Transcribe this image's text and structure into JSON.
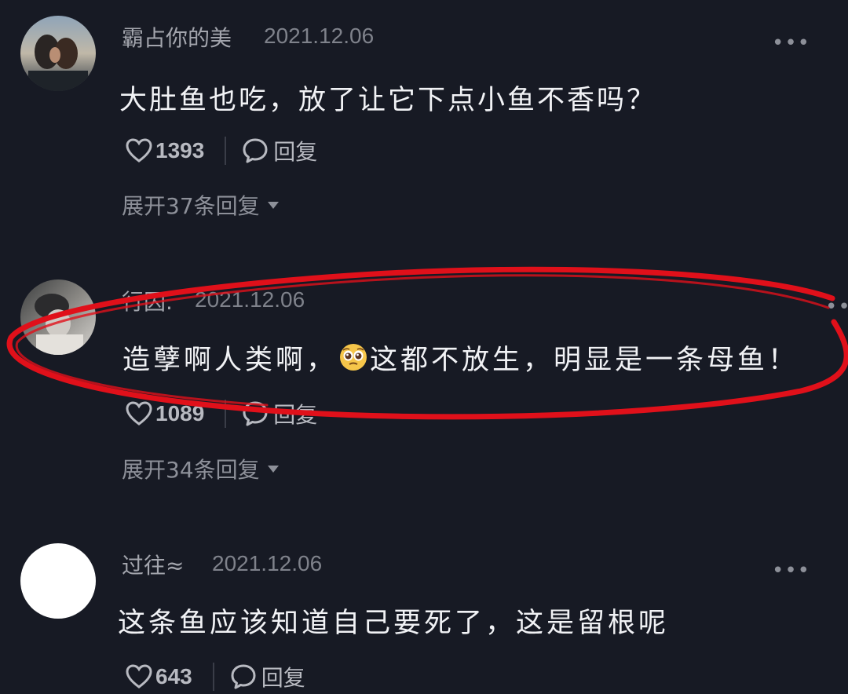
{
  "comments": [
    {
      "username": "霸占你的美",
      "date": "2021.12.06",
      "text": "大肚鱼也吃，放了让它下点小鱼不香吗？",
      "likes": "1393",
      "reply_label": "回复",
      "expand_label": "展开37条回复"
    },
    {
      "username": "行囚.",
      "date": "2021.12.06",
      "text_before": "造孽啊人类啊，",
      "text_after": "这都不放生，明显是一条母鱼！",
      "emoji": "pleading-face-emoji",
      "likes": "1089",
      "reply_label": "回复",
      "expand_label": "展开34条回复"
    },
    {
      "username": "过往≈",
      "date": "2021.12.06",
      "text": "这条鱼应该知道自己要死了，这是留根呢",
      "likes": "643",
      "reply_label": "回复"
    }
  ],
  "icons": {
    "like": "heart-outline-icon",
    "reply": "speech-bubble-icon",
    "more": "more-dots-icon",
    "expand": "caret-down-icon"
  },
  "colors": {
    "background": "#171a24",
    "annotation": "#e0101a"
  }
}
